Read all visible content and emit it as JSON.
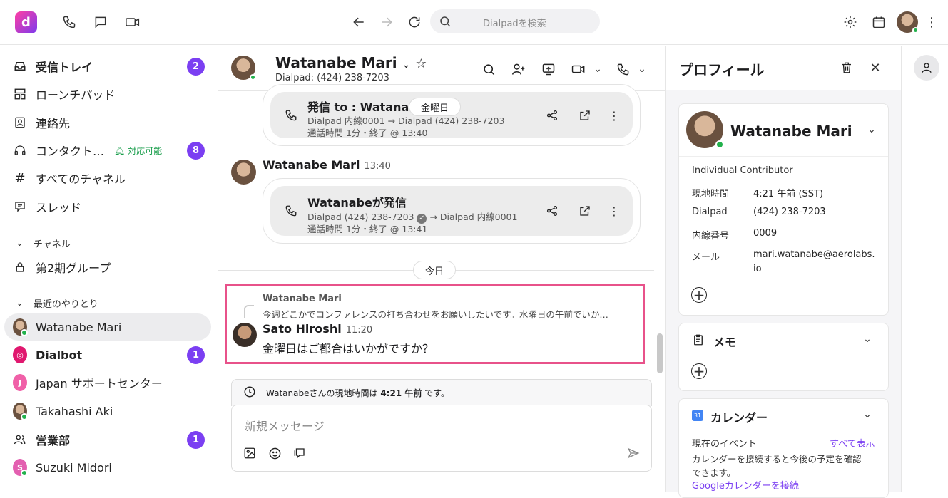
{
  "topbar": {
    "search_placeholder": "Dialpadを検索"
  },
  "sidebar": {
    "inbox": {
      "label": "受信トレイ",
      "count": "2"
    },
    "launchpad": "ローンチパッド",
    "contacts": "連絡先",
    "contact_center": {
      "label": "コンタクト…",
      "status": "対応可能",
      "count": "8"
    },
    "all_channels": "すべてのチャネル",
    "threads": "スレッド",
    "channels_header": "チャネル",
    "channel1": "第2期グループ",
    "recent_header": "最近のやりとり",
    "recent": [
      {
        "name": "Watanabe Mari",
        "initial": ""
      },
      {
        "name": "Dialbot",
        "count": "1"
      },
      {
        "name": "Japan サポートセンター",
        "initial": "J"
      },
      {
        "name": "Takahashi Aki"
      },
      {
        "name": "営業部",
        "count": "1"
      },
      {
        "name": "Suzuki Midori",
        "initial": "S"
      }
    ]
  },
  "chat": {
    "name": "Watanabe Mari",
    "sub": "Dialpad: (424) 238-7203",
    "card1": {
      "title": "発信 to : Watanabe",
      "line1": "Dialpad 内線0001 → Dialpad (424) 238-7203",
      "line2": "通話時間 1分・終了 @ 13:40"
    },
    "day_pill1": "金曜日",
    "msg1_name": "Watanabe Mari",
    "msg1_time": "13:40",
    "card2": {
      "title": "Watanabeが発信",
      "line1a": "Dialpad (424) 238-7203",
      "line1b": "→ Dialpad 内線0001",
      "line2": "通話時間 1分・終了 @ 13:41"
    },
    "day_pill2": "今日",
    "quote_name": "Watanabe Mari",
    "quote_text": "今週どこかでコンファレンスの打ち合わせをお願いしたいです。水曜日の午前でいか…",
    "msg2_name": "Sato Hiroshi",
    "msg2_time": "11:20",
    "msg2_text": "金曜日はご都合はいかがですか？",
    "tz_pre": "Watanabeさんの現地時間は",
    "tz_time": "4:21 午前",
    "tz_post": "です。",
    "compose_placeholder": "新規メッセージ"
  },
  "profile": {
    "title": "プロフィール",
    "name": "Watanabe Mari",
    "role": "Individual Contributor",
    "fields": [
      {
        "k": "現地時間",
        "v": "4:21 午前 (SST)"
      },
      {
        "k": "Dialpad",
        "v": "(424) 238-7203"
      },
      {
        "k": "内線番号",
        "v": "0009"
      },
      {
        "k": "メール",
        "v": "mari.watanabe@aerolabs."
      },
      {
        "k": "",
        "v": "io"
      }
    ],
    "memo": "メモ",
    "calendar": "カレンダー",
    "current_event": "現在のイベント",
    "show_all": "すべて表示",
    "cal_desc1": "カレンダーを接続すると今後の予定を確認",
    "cal_desc2": "できます。",
    "google_link": "Googleカレンダーを接続"
  },
  "colors": {
    "accent": "#7b3ff2",
    "highlight": "#e8528a",
    "online": "#22b14c"
  }
}
